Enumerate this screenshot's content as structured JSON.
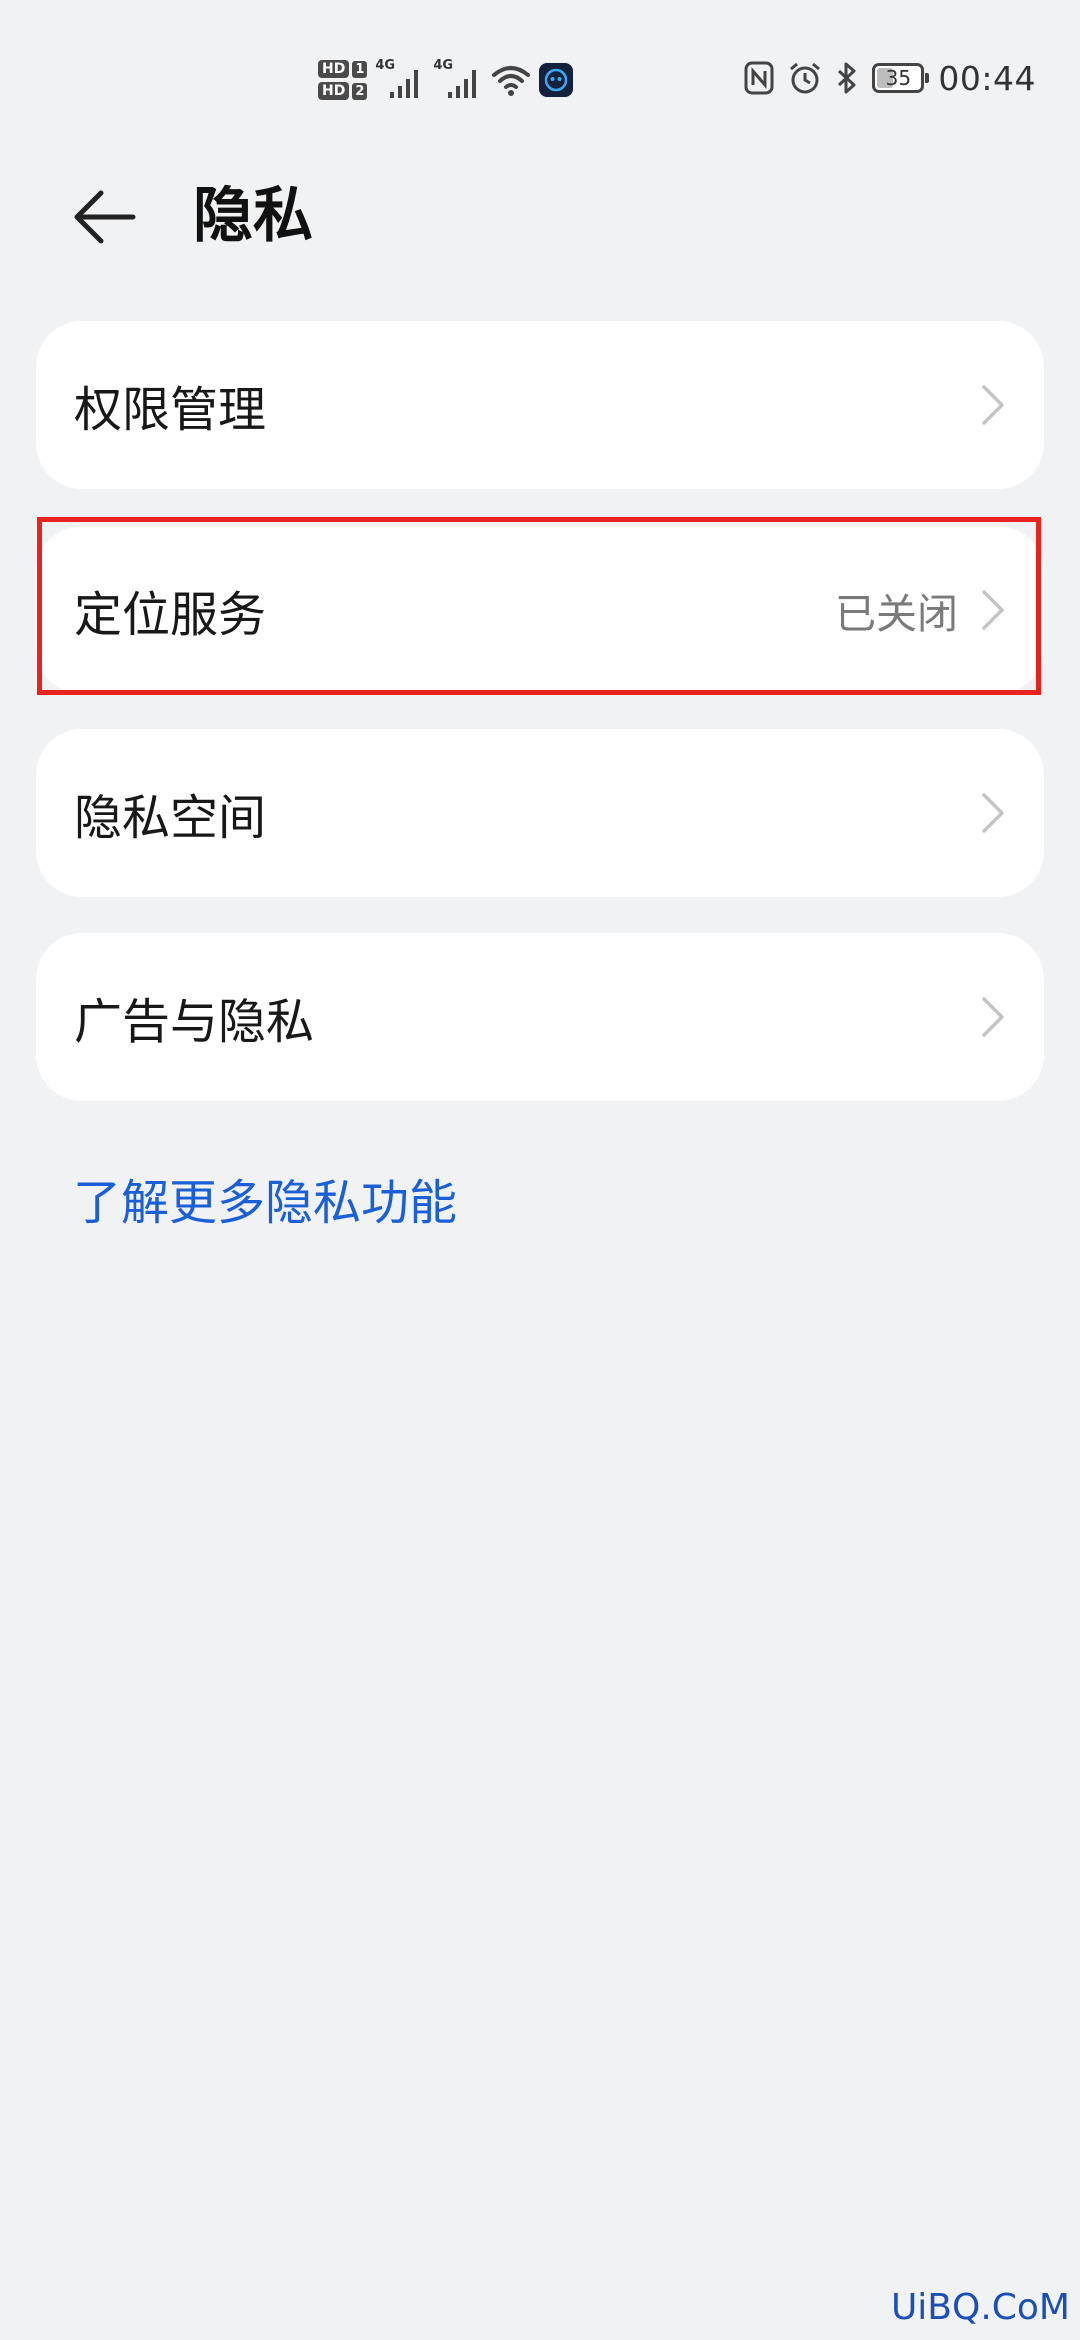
{
  "status_bar": {
    "sim1_label": "HD",
    "sim1_num": "1",
    "sim2_label": "HD",
    "sim2_num": "2",
    "network1": "4G",
    "network2": "4G",
    "battery_level": "35",
    "time": "00:44",
    "icons": [
      "signal-icon",
      "wifi-icon",
      "app-icon",
      "nfc-icon",
      "alarm-icon",
      "bluetooth-icon",
      "battery-icon"
    ]
  },
  "header": {
    "back_icon": "arrow-left-icon",
    "title": "隐私"
  },
  "settings": {
    "items": [
      {
        "label": "权限管理",
        "value": ""
      },
      {
        "label": "定位服务",
        "value": "已关闭"
      },
      {
        "label": "隐私空间",
        "value": ""
      },
      {
        "label": "广告与隐私",
        "value": ""
      }
    ]
  },
  "learn_more": "了解更多隐私功能",
  "watermark": "UiBQ.CoM",
  "colors": {
    "background": "#f1f2f4",
    "card": "#ffffff",
    "link": "#1a5fd6",
    "highlight": "#e8231f"
  }
}
